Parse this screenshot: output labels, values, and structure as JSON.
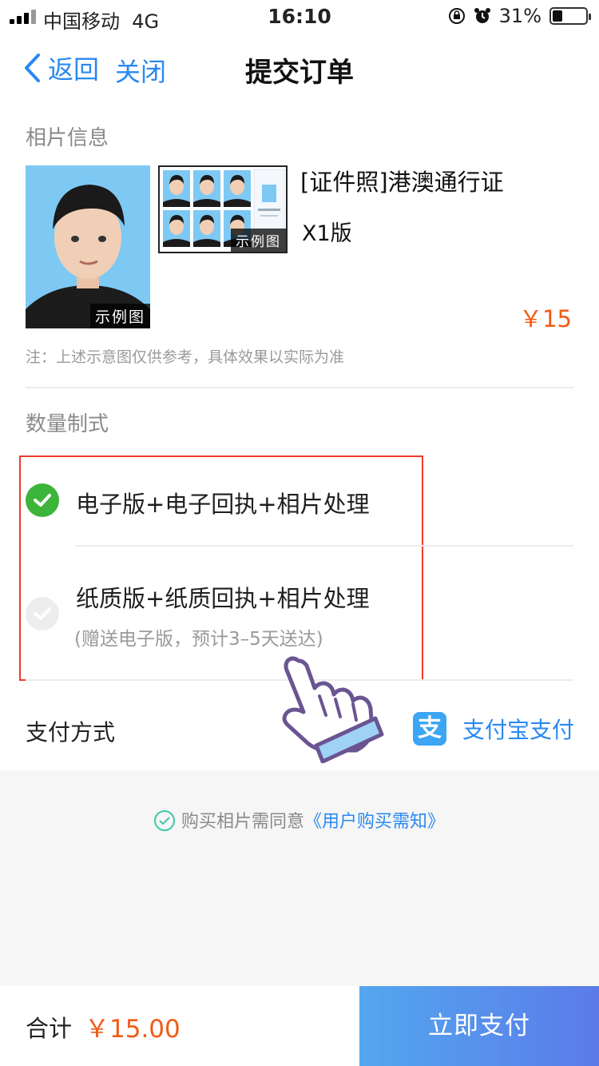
{
  "status_bar": {
    "carrier": "中国移动",
    "network": "4G",
    "time": "16:10",
    "battery": "31%",
    "battery_level": 0.31
  },
  "nav": {
    "back_label": "返回",
    "close_label": "关闭",
    "title": "提交订单"
  },
  "photo_info": {
    "section_label": "相片信息",
    "sample_tag_main": "示例图",
    "sample_tag_sheet": "示例图",
    "product_name": "[证件照]港澳通行证",
    "product_version": "X1版",
    "price": "￥15",
    "note": "注：上述示意图仅供参考，具体效果以实际为准"
  },
  "quantity": {
    "section_label": "数量制式",
    "options": [
      {
        "label": "电子版+电子回执+相片处理",
        "sub": "",
        "selected": true
      },
      {
        "label": "纸质版+纸质回执+相片处理",
        "sub": "(赠送电子版，预计3–5天送达)",
        "selected": false
      }
    ]
  },
  "payment": {
    "label": "支付方式",
    "method_logo": "支",
    "method": "支付宝支付"
  },
  "agreement": {
    "text": "购买相片需同意",
    "link": "《用户购买需知》"
  },
  "footer": {
    "total_label": "合计",
    "total_value": "￥15.00",
    "pay_button": "立即支付"
  },
  "colors": {
    "accent": "#2a89f0",
    "price": "#f25a15",
    "selected": "#3db43a",
    "highlight_border": "#ef3a2d"
  },
  "icons": {
    "back": "chevron-left-icon",
    "check": "check-circle-icon",
    "alipay": "alipay-icon",
    "pointer": "hand-pointer-icon"
  }
}
